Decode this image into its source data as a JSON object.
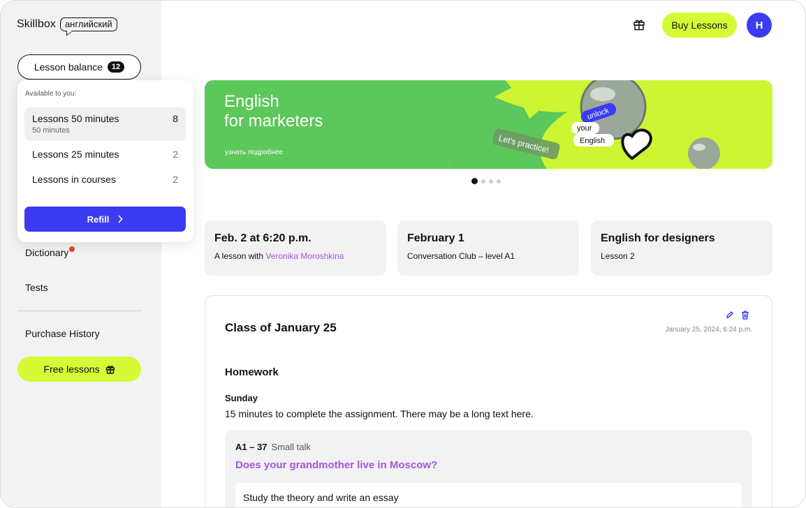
{
  "brand": {
    "name": "Skillbox",
    "tag": "английский"
  },
  "sidebar": {
    "balance_label": "Lesson balance",
    "balance_count": "12",
    "dropdown": {
      "heading": "Available to you:",
      "items": [
        {
          "label": "Lessons 50 minutes",
          "sub": "50 minutes",
          "count": "8"
        },
        {
          "label": "Lessons 25 minutes",
          "count": "2"
        },
        {
          "label": "Lessons in courses",
          "count": "2"
        }
      ],
      "refill_label": "Refill"
    },
    "nav": {
      "dictionary": "Dictionary",
      "tests": "Tests",
      "purchase_history": "Purchase History"
    },
    "free_lessons_label": "Free lessons"
  },
  "header": {
    "buy_label": "Buy Lessons",
    "avatar_initial": "H"
  },
  "banner": {
    "title_line1": "English",
    "title_line2": "for marketers",
    "link": "узнать подробнее",
    "stickers": {
      "unlock": "unlock",
      "your": "your",
      "english": "English",
      "practice": "Let's practice!"
    },
    "slides_total": 4,
    "active_slide": 1
  },
  "events": [
    {
      "title": "Feb. 2 at 6:20 p.m.",
      "sub_prefix": "A lesson with ",
      "sub_link": "Veronika Moroshkina"
    },
    {
      "title": "February 1",
      "sub": "Conversation Club – level A1"
    },
    {
      "title": "English for designers",
      "sub": "Lesson 2"
    }
  ],
  "lesson": {
    "title": "Class of January 25",
    "date": "January 25, 2024, 6:24 p.m.",
    "homework_heading": "Homework",
    "day": "Sunday",
    "task_text": "15 minutes to complete the assignment. There may be a long text here.",
    "task": {
      "code": "A1 – 37",
      "topic": "Small talk",
      "question": "Does your grandmother live in Moscow?",
      "instruction": "Study the theory and write an essay"
    }
  },
  "colors": {
    "accent_blue": "#3b3cf1",
    "lime": "#d4fb36",
    "banner_green": "#5cc75a",
    "link_purple": "#a455e0",
    "notify_red": "#e8432d"
  }
}
